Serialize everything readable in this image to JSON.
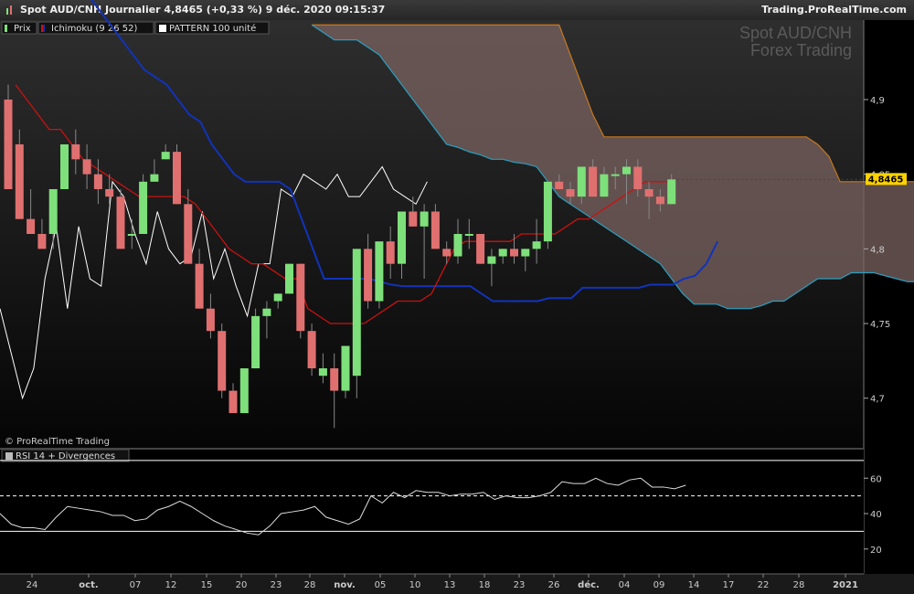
{
  "header": {
    "title": "Spot AUD/CNH Journalier 4,8465 (+0,33 %) 9 déc. 2020 09:15:37",
    "site": "Trading.ProRealTime.com"
  },
  "watermark": {
    "line1": "Spot AUD/CNH",
    "line2": "Forex Trading"
  },
  "copyright": "© ProRealTime Trading",
  "legend": [
    {
      "label": "Prix",
      "icon": "candles-icon"
    },
    {
      "label": "Ichimoku (9 26 52)",
      "icon": "ichimoku-icon"
    },
    {
      "label": "PATTERN 100 unité",
      "icon": "white-square-icon"
    }
  ],
  "rsi_panel": {
    "label": "RSI 14 + Divergences"
  },
  "colors": {
    "bull": "#7ee07a",
    "bear": "#e07070",
    "tenkan": "#cc1111",
    "kijun": "#1133bb",
    "cloud": "#7a6360",
    "senkou_a": "#2a9fc0",
    "senkou_b": "#c8781e",
    "pattern": "#ffffff",
    "price_tag": "#ffd200"
  },
  "chart_data": [
    {
      "type": "candlestick",
      "title": "Spot AUD/CNH Journalier",
      "current_price": "4,8465",
      "ylim": [
        4.668,
        4.952
      ],
      "yticks": [
        "4,9",
        "4,85",
        "4,8",
        "4,75",
        "4,7"
      ],
      "ytick_values": [
        4.9,
        4.85,
        4.8,
        4.75,
        4.7
      ],
      "xticks": [
        "24",
        "oct.",
        "07",
        "12",
        "15",
        "20",
        "23",
        "28",
        "nov.",
        "05",
        "10",
        "13",
        "18",
        "23",
        "26",
        "déc.",
        "04",
        "09",
        "14",
        "17",
        "22",
        "28",
        "2021"
      ],
      "candles": [
        [
          4.9,
          4.91,
          4.847,
          4.84
        ],
        [
          4.87,
          4.88,
          4.82,
          4.82
        ],
        [
          4.82,
          4.84,
          4.81,
          4.81
        ],
        [
          4.81,
          4.82,
          4.8,
          4.8
        ],
        [
          4.81,
          4.84,
          4.8,
          4.84
        ],
        [
          4.84,
          4.87,
          4.84,
          4.87
        ],
        [
          4.87,
          4.88,
          4.85,
          4.86
        ],
        [
          4.86,
          4.87,
          4.84,
          4.85
        ],
        [
          4.85,
          4.86,
          4.83,
          4.84
        ],
        [
          4.84,
          4.85,
          4.83,
          4.835
        ],
        [
          4.835,
          4.84,
          4.8,
          4.8
        ],
        [
          4.81,
          4.82,
          4.8,
          4.81
        ],
        [
          4.81,
          4.85,
          4.81,
          4.845
        ],
        [
          4.845,
          4.86,
          4.845,
          4.85
        ],
        [
          4.86,
          4.87,
          4.86,
          4.865
        ],
        [
          4.865,
          4.87,
          4.83,
          4.83
        ],
        [
          4.83,
          4.84,
          4.79,
          4.79
        ],
        [
          4.79,
          4.8,
          4.76,
          4.76
        ],
        [
          4.76,
          4.77,
          4.74,
          4.745
        ],
        [
          4.745,
          4.75,
          4.7,
          4.705
        ],
        [
          4.705,
          4.71,
          4.69,
          4.69
        ],
        [
          4.69,
          4.72,
          4.69,
          4.72
        ],
        [
          4.72,
          4.76,
          4.72,
          4.755
        ],
        [
          4.755,
          4.765,
          4.74,
          4.76
        ],
        [
          4.765,
          4.77,
          4.76,
          4.77
        ],
        [
          4.77,
          4.79,
          4.77,
          4.79
        ],
        [
          4.79,
          4.79,
          4.74,
          4.745
        ],
        [
          4.745,
          4.75,
          4.715,
          4.72
        ],
        [
          4.715,
          4.73,
          4.71,
          4.72
        ],
        [
          4.72,
          4.73,
          4.68,
          4.705
        ],
        [
          4.705,
          4.735,
          4.7,
          4.735
        ],
        [
          4.715,
          4.8,
          4.7,
          4.8
        ],
        [
          4.8,
          4.81,
          4.76,
          4.765
        ],
        [
          4.765,
          4.8,
          4.76,
          4.805
        ],
        [
          4.805,
          4.815,
          4.78,
          4.79
        ],
        [
          4.79,
          4.825,
          4.78,
          4.825
        ],
        [
          4.825,
          4.835,
          4.815,
          4.815
        ],
        [
          4.815,
          4.83,
          4.78,
          4.825
        ],
        [
          4.825,
          4.83,
          4.8,
          4.8
        ],
        [
          4.8,
          4.805,
          4.79,
          4.795
        ],
        [
          4.795,
          4.82,
          4.79,
          4.81
        ],
        [
          4.81,
          4.82,
          4.8,
          4.81
        ],
        [
          4.81,
          4.81,
          4.79,
          4.79
        ],
        [
          4.79,
          4.8,
          4.775,
          4.795
        ],
        [
          4.795,
          4.8,
          4.79,
          4.8
        ],
        [
          4.8,
          4.81,
          4.79,
          4.795
        ],
        [
          4.795,
          4.8,
          4.785,
          4.8
        ],
        [
          4.8,
          4.82,
          4.79,
          4.805
        ],
        [
          4.805,
          4.845,
          4.8,
          4.845
        ],
        [
          4.845,
          4.85,
          4.84,
          4.84
        ],
        [
          4.84,
          4.845,
          4.83,
          4.835
        ],
        [
          4.835,
          4.855,
          4.83,
          4.855
        ],
        [
          4.855,
          4.86,
          4.835,
          4.835
        ],
        [
          4.835,
          4.855,
          4.835,
          4.85
        ],
        [
          4.85,
          4.855,
          4.84,
          4.85
        ],
        [
          4.85,
          4.86,
          4.83,
          4.855
        ],
        [
          4.855,
          4.86,
          4.835,
          4.84
        ],
        [
          4.84,
          4.845,
          4.82,
          4.835
        ],
        [
          4.835,
          4.84,
          4.825,
          4.83
        ],
        [
          4.83,
          4.85,
          4.83,
          4.8465
        ]
      ],
      "tenkan": [
        4.91,
        4.9,
        4.89,
        4.88,
        4.88,
        4.87,
        4.86,
        4.855,
        4.85,
        4.845,
        4.84,
        4.835,
        4.835,
        4.835,
        4.835,
        4.835,
        4.83,
        4.82,
        4.81,
        4.8,
        4.795,
        4.79,
        4.79,
        4.785,
        4.78,
        4.78,
        4.76,
        4.755,
        4.75,
        4.75,
        4.75,
        4.75,
        4.755,
        4.76,
        4.765,
        4.765,
        4.765,
        4.77,
        4.785,
        4.8,
        4.805,
        4.805,
        4.805,
        4.805,
        4.805,
        4.81,
        4.81,
        4.81,
        4.81,
        4.815,
        4.82,
        4.82,
        4.825,
        4.83,
        4.835,
        4.84,
        4.845,
        4.845,
        4.845
      ],
      "kijun": [
        4.98,
        4.97,
        4.96,
        4.95,
        4.94,
        4.93,
        4.92,
        4.915,
        4.91,
        4.9,
        4.89,
        4.885,
        4.87,
        4.86,
        4.85,
        4.845,
        4.845,
        4.845,
        4.845,
        4.84,
        4.82,
        4.8,
        4.78,
        4.78,
        4.78,
        4.78,
        4.78,
        4.778,
        4.776,
        4.775,
        4.775,
        4.775,
        4.775,
        4.775,
        4.775,
        4.775,
        4.77,
        4.765,
        4.765,
        4.765,
        4.765,
        4.765,
        4.767,
        4.767,
        4.767,
        4.774,
        4.774,
        4.774,
        4.774,
        4.774,
        4.774,
        4.776,
        4.776,
        4.776,
        4.78,
        4.782,
        4.79,
        4.805
      ],
      "senkou_a": [
        4.95,
        4.945,
        4.94,
        4.94,
        4.94,
        4.935,
        4.93,
        4.92,
        4.91,
        4.9,
        4.89,
        4.88,
        4.87,
        4.868,
        4.865,
        4.863,
        4.86,
        4.86,
        4.858,
        4.857,
        4.855,
        4.845,
        4.835,
        4.83,
        4.825,
        4.82,
        4.815,
        4.81,
        4.805,
        4.8,
        4.795,
        4.79,
        4.78,
        4.77,
        4.763,
        4.763,
        4.763,
        4.76,
        4.76,
        4.76,
        4.762,
        4.765,
        4.765,
        4.77,
        4.775,
        4.78,
        4.78,
        4.78,
        4.784,
        4.784,
        4.784,
        4.782,
        4.78,
        4.778,
        4.778,
        4.78,
        4.782,
        4.784,
        4.784,
        4.784
      ],
      "senkou_b": [
        4.95,
        4.95,
        4.95,
        4.95,
        4.95,
        4.95,
        4.95,
        4.95,
        4.95,
        4.95,
        4.95,
        4.95,
        4.95,
        4.95,
        4.95,
        4.95,
        4.95,
        4.95,
        4.95,
        4.95,
        4.95,
        4.95,
        4.95,
        4.93,
        4.91,
        4.89,
        4.875,
        4.875,
        4.875,
        4.875,
        4.875,
        4.875,
        4.875,
        4.875,
        4.875,
        4.875,
        4.875,
        4.875,
        4.875,
        4.875,
        4.875,
        4.875,
        4.875,
        4.875,
        4.875,
        4.87,
        4.862,
        4.845,
        4.845,
        4.845,
        4.845,
        4.845,
        4.845,
        4.845,
        4.845,
        4.845,
        4.845,
        4.845,
        4.845,
        4.845
      ],
      "senkou_a_start": 27,
      "pattern": [
        4.76,
        4.73,
        4.7,
        4.72,
        4.78,
        4.815,
        4.76,
        4.815,
        4.78,
        4.775,
        4.845,
        4.835,
        4.81,
        4.79,
        4.825,
        4.8,
        4.79,
        4.795,
        4.825,
        4.78,
        4.8,
        4.775,
        4.755,
        4.79,
        4.79,
        4.84,
        4.835,
        4.85,
        4.845,
        4.84,
        4.85,
        4.835,
        4.835,
        4.845,
        4.855,
        4.84,
        4.835,
        4.83,
        4.845
      ]
    },
    {
      "type": "line",
      "title": "RSI 14 + Divergences",
      "ylim": [
        8,
        72
      ],
      "yticks": [
        "60",
        "40",
        "20"
      ],
      "ytick_values": [
        60,
        40,
        20
      ],
      "levels": [
        70,
        30
      ],
      "midline": 50,
      "values": [
        40,
        34,
        32,
        32,
        31,
        38,
        44,
        43,
        42,
        41,
        39,
        39,
        36,
        37,
        42,
        44,
        47,
        44,
        40,
        36,
        33,
        31,
        29,
        28,
        33,
        40,
        41,
        42,
        44,
        38,
        36,
        34,
        37,
        50,
        46,
        52,
        49,
        53,
        52,
        52,
        50,
        51,
        51,
        52,
        48,
        50,
        49,
        49,
        50,
        52,
        58,
        57,
        57,
        60,
        57,
        56,
        59,
        60,
        55,
        55,
        54,
        56
      ]
    }
  ]
}
